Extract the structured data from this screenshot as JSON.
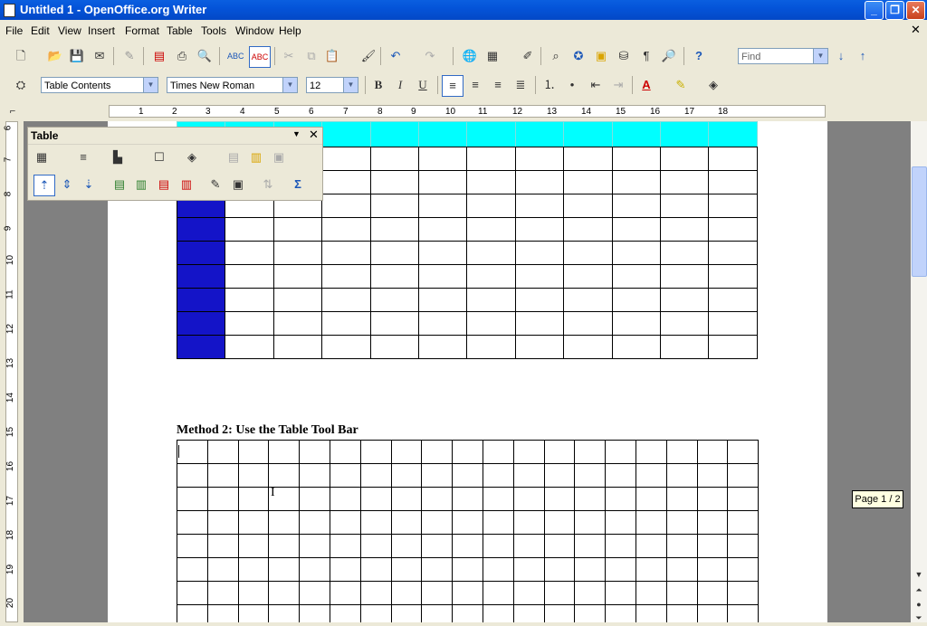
{
  "window": {
    "title": "Untitled 1 - OpenOffice.org Writer"
  },
  "menu": [
    "File",
    "Edit",
    "View",
    "Insert",
    "Format",
    "Table",
    "Tools",
    "Window",
    "Help"
  ],
  "toolbar": {
    "find_placeholder": "Find"
  },
  "formatting": {
    "paragraph_style": "Table Contents",
    "font_name": "Times New Roman",
    "font_size": "12"
  },
  "ruler": {
    "h_numbers": [
      "1",
      "2",
      "3",
      "4",
      "5",
      "6",
      "7",
      "8",
      "9",
      "10",
      "11",
      "12",
      "13",
      "14",
      "15",
      "16",
      "17",
      "18"
    ],
    "v_numbers": [
      "6",
      "7",
      "8",
      "9",
      "10",
      "11",
      "12",
      "13",
      "14",
      "15",
      "16",
      "17",
      "18",
      "19",
      "20"
    ]
  },
  "table_toolbar": {
    "title": "Table"
  },
  "document": {
    "heading": "Method 2: Use the Table Tool Bar"
  },
  "status": {
    "page_indicator": "Page 1 / 2"
  },
  "colors": {
    "header_row": "#00ffff",
    "first_column": "#1414c8",
    "title_bar": "#0454d9"
  }
}
